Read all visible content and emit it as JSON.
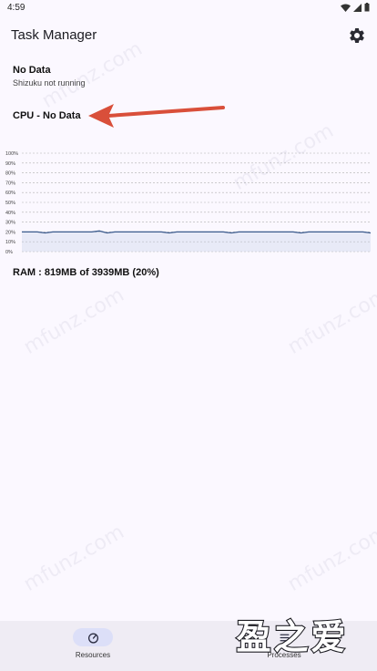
{
  "status_bar": {
    "time": "4:59",
    "icons": [
      "wifi-icon",
      "signal-icon",
      "battery-icon"
    ]
  },
  "app_bar": {
    "title": "Task Manager",
    "action_icon": "gear-icon"
  },
  "shizuku": {
    "title": "No Data",
    "subtitle": "Shizuku not running"
  },
  "cpu": {
    "label": "CPU - No Data"
  },
  "ram": {
    "label": "RAM : 819MB of 3939MB (20%)"
  },
  "chart_data": {
    "type": "line",
    "title": "",
    "xlabel": "",
    "ylabel": "",
    "ylim": [
      0,
      100
    ],
    "y_ticks": [
      "0%",
      "10%",
      "20%",
      "30%",
      "40%",
      "50%",
      "60%",
      "70%",
      "80%",
      "90%",
      "100%"
    ],
    "grid": true,
    "series": [
      {
        "values": [
          20,
          20,
          20,
          19,
          20,
          20,
          20,
          20,
          20,
          20,
          21,
          19,
          20,
          20,
          20,
          20,
          20,
          20,
          20,
          19,
          20,
          20,
          20,
          20,
          20,
          20,
          20,
          19,
          20,
          20,
          20,
          20,
          20,
          20,
          20,
          20,
          19,
          20,
          20,
          20,
          20,
          20,
          20,
          20,
          20,
          19
        ]
      }
    ],
    "colors": {
      "line": "#3a5a8c",
      "fill": "#c7d0e8",
      "grid": "#b0b0b0"
    }
  },
  "bottom_nav": {
    "items": [
      {
        "label": "Resources",
        "icon": "gauge-icon",
        "active": true
      },
      {
        "label": "Processes",
        "icon": "list-icon",
        "active": false
      }
    ]
  },
  "overlay": {
    "logo_text": "盈之爱",
    "watermark": "mfunz.com",
    "arrow_color": "#d94f3a"
  }
}
